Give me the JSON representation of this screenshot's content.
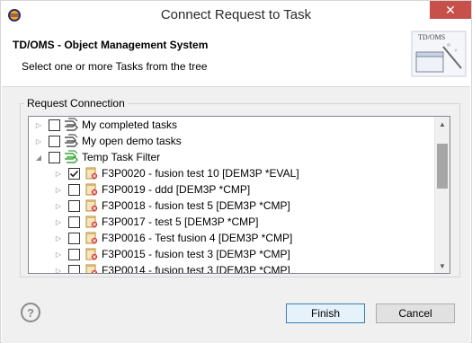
{
  "window": {
    "title": "Connect Request to Task",
    "close_label": "✕"
  },
  "header": {
    "title": "TD/OMS - Object Management System",
    "subtitle": "Select one or more Tasks from the tree",
    "graphic_label": "TD/OMS"
  },
  "group": {
    "label": "Request Connection"
  },
  "tree": {
    "items": [
      {
        "label": "My completed tasks",
        "level": 0,
        "expander": "collapsed",
        "checked": false,
        "icon": "task-filter-icon"
      },
      {
        "label": "My open demo tasks",
        "level": 0,
        "expander": "collapsed",
        "checked": false,
        "icon": "task-filter-icon"
      },
      {
        "label": "Temp Task Filter",
        "level": 0,
        "expander": "expanded",
        "checked": false,
        "icon": "task-filter-active-icon"
      },
      {
        "label": "F3P0020 - fusion test 10 [DEM3P *EVAL]",
        "level": 1,
        "expander": "collapsed",
        "checked": true,
        "icon": "task-item-icon"
      },
      {
        "label": "F3P0019 - ddd [DEM3P *CMP]",
        "level": 1,
        "expander": "collapsed",
        "checked": false,
        "icon": "task-item-icon"
      },
      {
        "label": "F3P0018 - fusion test 5 [DEM3P *CMP]",
        "level": 1,
        "expander": "collapsed",
        "checked": false,
        "icon": "task-item-icon"
      },
      {
        "label": "F3P0017 - test 5 [DEM3P *CMP]",
        "level": 1,
        "expander": "collapsed",
        "checked": false,
        "icon": "task-item-icon"
      },
      {
        "label": "F3P0016 - Test fusion 4 [DEM3P *CMP]",
        "level": 1,
        "expander": "collapsed",
        "checked": false,
        "icon": "task-item-icon"
      },
      {
        "label": "F3P0015 - fusion test 3 [DEM3P *CMP]",
        "level": 1,
        "expander": "collapsed",
        "checked": false,
        "icon": "task-item-icon"
      },
      {
        "label": "F3P0014 - fusion test 3 [DEM3P *CMP]",
        "level": 1,
        "expander": "collapsed",
        "checked": false,
        "icon": "task-item-icon"
      }
    ]
  },
  "footer": {
    "help_label": "?",
    "finish_label": "Finish",
    "cancel_label": "Cancel"
  },
  "colors": {
    "accent": "#3c7fb1",
    "close": "#c7504b",
    "filter_active": "#3aa53a"
  }
}
